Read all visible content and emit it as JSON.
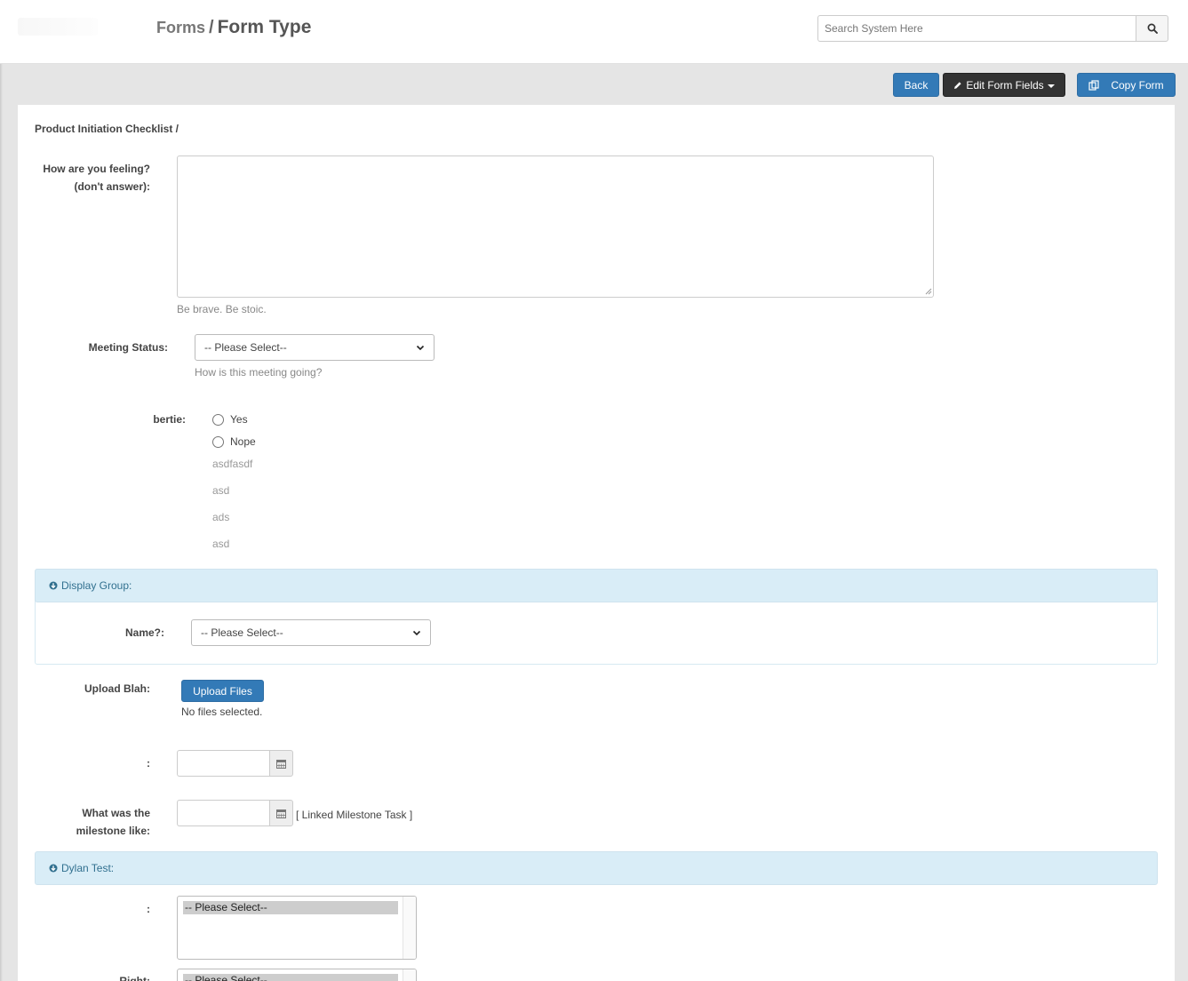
{
  "header": {
    "breadcrumb_parent": "Forms",
    "breadcrumb_sep": "/",
    "breadcrumb_current": "Form Type",
    "search_placeholder": "Search System Here"
  },
  "toolbar": {
    "back_label": "Back",
    "edit_label": "Edit Form Fields",
    "copy_label": "Copy Form"
  },
  "form": {
    "title": "Product Initiation Checklist /",
    "feeling": {
      "label_line1": "How are you feeling?",
      "label_line2": "(don't answer):",
      "help": "Be brave. Be stoic."
    },
    "meeting_status": {
      "label": "Meeting Status:",
      "selected": "-- Please Select--",
      "help": "How is this meeting going?"
    },
    "bertie": {
      "label": "bertie:",
      "options": [
        "Yes",
        "Nope"
      ],
      "extra_options": [
        "asdfasdf",
        "asd",
        "ads",
        "asd"
      ]
    },
    "display_group": {
      "title": "Display Group:",
      "name_label": "Name?:",
      "name_selected": "-- Please Select--"
    },
    "upload": {
      "label": "Upload Blah:",
      "button": "Upload Files",
      "status": "No files selected."
    },
    "date1": {
      "label": ":"
    },
    "milestone": {
      "label_line1": "What was the",
      "label_line2": "milestone like:",
      "linked": "[ Linked Milestone Task ]"
    },
    "dylan_group": {
      "title": "Dylan Test:",
      "list1_label": ":",
      "list1_selected": "-- Please Select--",
      "list2_label": "Right:",
      "list2_selected": "-- Please Select--"
    }
  },
  "colors": {
    "primary": "#337ab7",
    "dark": "#333333",
    "group_header_bg": "#d9edf7",
    "group_header_text": "#31708f"
  }
}
